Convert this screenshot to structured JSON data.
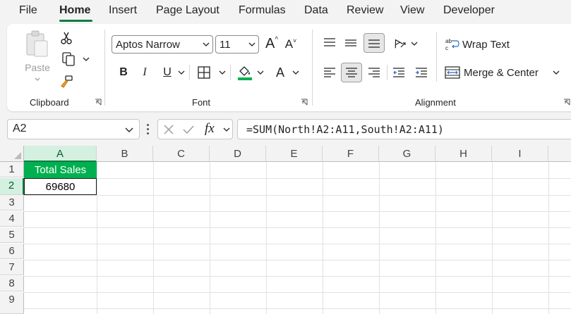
{
  "menu": {
    "tabs": [
      "File",
      "Home",
      "Insert",
      "Page Layout",
      "Formulas",
      "Data",
      "Review",
      "View",
      "Developer"
    ],
    "active": "Home"
  },
  "ribbon": {
    "clipboard": {
      "paste_label": "Paste",
      "group_label": "Clipboard"
    },
    "font": {
      "font_name": "Aptos Narrow",
      "font_size": "11",
      "grow_label": "A",
      "shrink_label": "A",
      "bold_label": "B",
      "italic_label": "I",
      "underline_label": "U",
      "font_color_label": "A",
      "group_label": "Font",
      "fill_color": "#00b050",
      "font_color": "#242424"
    },
    "alignment": {
      "wrap_text_label": "Wrap Text",
      "merge_center_label": "Merge & Center",
      "group_label": "Alignment"
    }
  },
  "formula_bar": {
    "name_box": "A2",
    "fx_label": "fx",
    "formula": "=SUM(North!A2:A11,South!A2:A11)"
  },
  "sheet": {
    "columns": [
      "A",
      "B",
      "C",
      "D",
      "E",
      "F",
      "G",
      "H",
      "I"
    ],
    "rows": [
      "1",
      "2",
      "3",
      "4",
      "5",
      "6",
      "7",
      "8",
      "9"
    ],
    "cells": {
      "A1": "Total Sales",
      "A2": "69680"
    },
    "header_fill": "#00b050",
    "accent": "#107c41"
  }
}
